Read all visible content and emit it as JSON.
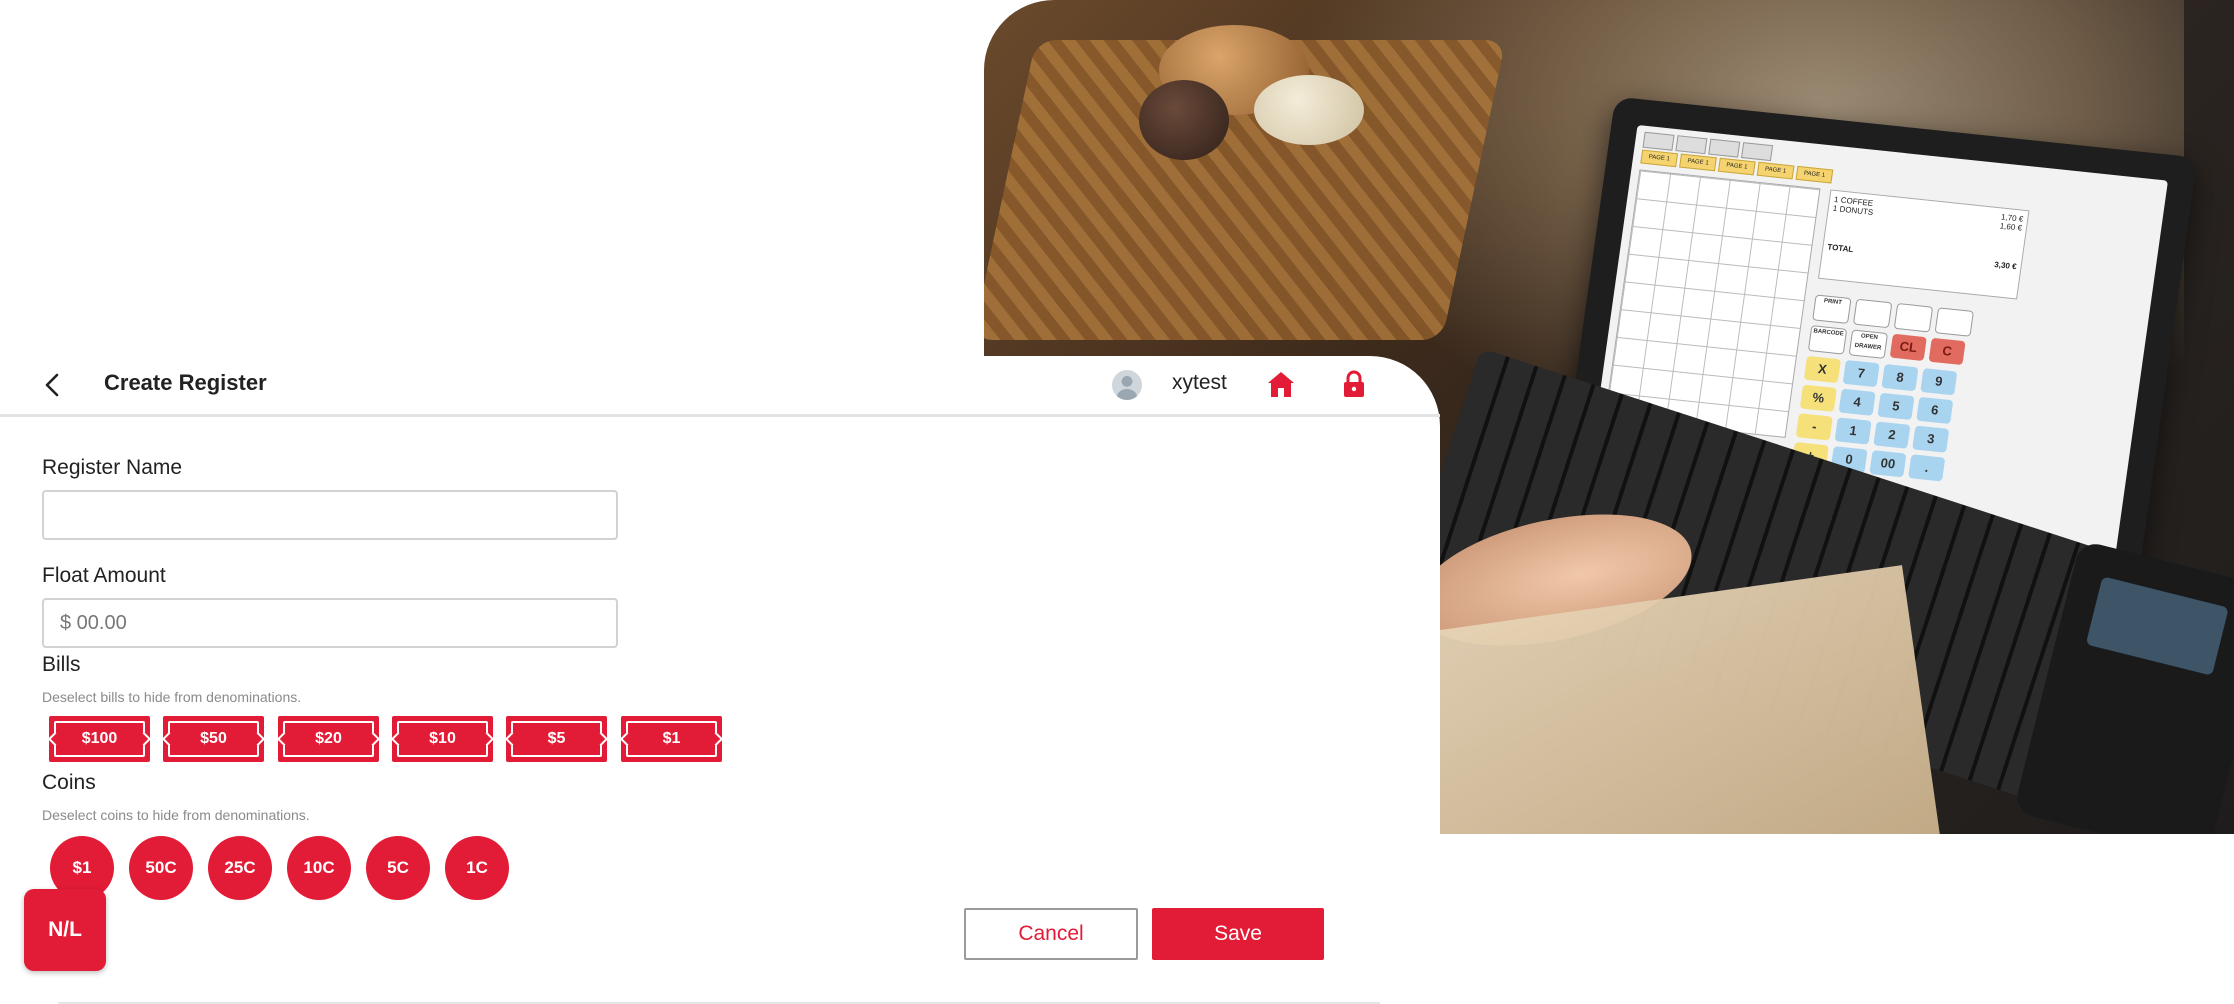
{
  "header": {
    "back_icon": "chevron-left-icon",
    "title": "Create Register",
    "username": "xytest",
    "home_icon": "home-icon",
    "lock_icon": "lock-icon"
  },
  "form": {
    "register_name_label": "Register Name",
    "register_name_value": "",
    "register_name_placeholder": "",
    "float_amount_label": "Float Amount",
    "float_amount_placeholder": "$ 00.00"
  },
  "bills": {
    "title": "Bills",
    "hint": "Deselect bills to hide from denominations.",
    "items": [
      "$100",
      "$50",
      "$20",
      "$10",
      "$5",
      "$1"
    ]
  },
  "coins": {
    "title": "Coins",
    "hint": "Deselect coins to hide from denominations.",
    "items": [
      "$1",
      "50C",
      "25C",
      "10C",
      "5C",
      "1C"
    ]
  },
  "actions": {
    "nl_label": "N/L",
    "cancel_label": "Cancel",
    "save_label": "Save"
  },
  "photo": {
    "screen_tabs": [
      "",
      "",
      "",
      ""
    ],
    "screen_pages": [
      "PAGE 1",
      "PAGE 1",
      "PAGE 1",
      "PAGE 1",
      "PAGE 1"
    ],
    "receipt_lines": [
      {
        "item": "1 COFFEE",
        "price": "1,70 €"
      },
      {
        "item": "1 DONUTS",
        "price": "1,60 €"
      }
    ],
    "total_label": "TOTAL",
    "total_value": "3,30 €",
    "key_rows": [
      [
        "PRINT",
        "",
        "",
        ""
      ],
      [
        "BARCODE",
        "OPEN DRAWER",
        "CL",
        "C"
      ],
      [
        "X",
        "7",
        "8",
        "9"
      ],
      [
        "%",
        "4",
        "5",
        "6"
      ],
      [
        "-",
        "1",
        "2",
        "3"
      ],
      [
        "+",
        "0",
        "00",
        "."
      ]
    ]
  },
  "colors": {
    "accent": "#e21b36",
    "border": "#d2d2d2",
    "hint_text": "#8a8a8a"
  }
}
